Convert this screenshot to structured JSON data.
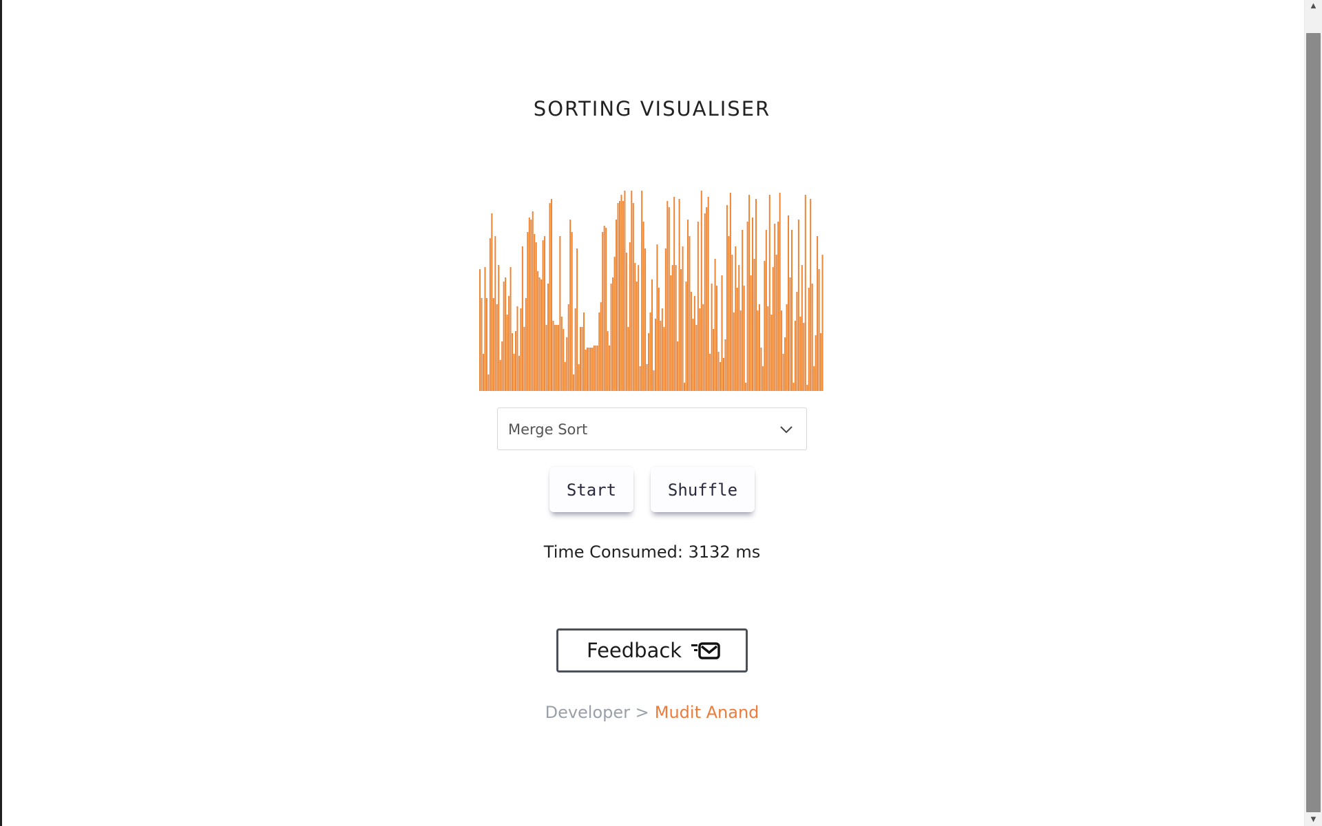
{
  "title": "SORTING VISUALISER",
  "chart_data": {
    "type": "bar",
    "bar_color": "#ef8432",
    "values": [
      59,
      45,
      18,
      60,
      45,
      8,
      74,
      86,
      45,
      75,
      42,
      61,
      15,
      24,
      53,
      55,
      37,
      46,
      60,
      28,
      18,
      29,
      41,
      17,
      40,
      70,
      31,
      45,
      77,
      84,
      83,
      87,
      76,
      72,
      58,
      55,
      54,
      73,
      75,
      32,
      52,
      91,
      93,
      34,
      32,
      32,
      32,
      75,
      36,
      30,
      14,
      26,
      42,
      83,
      77,
      8,
      40,
      69,
      13,
      31,
      31,
      38,
      20,
      21,
      21,
      21,
      21,
      22,
      22,
      22,
      38,
      43,
      77,
      80,
      79,
      29,
      22,
      52,
      55,
      65,
      83,
      91,
      92,
      95,
      92,
      97,
      67,
      31,
      72,
      97,
      91,
      62,
      53,
      61,
      12,
      97,
      82,
      69,
      13,
      28,
      38,
      54,
      10,
      35,
      71,
      50,
      34,
      40,
      31,
      69,
      92,
      89,
      56,
      61,
      94,
      61,
      24,
      93,
      59,
      70,
      4,
      53,
      83,
      75,
      48,
      35,
      46,
      32,
      82,
      40,
      97,
      42,
      86,
      89,
      94,
      18,
      52,
      30,
      64,
      51,
      19,
      14,
      56,
      16,
      25,
      90,
      75,
      96,
      66,
      38,
      70,
      50,
      61,
      39,
      78,
      51,
      4,
      82,
      95,
      56,
      84,
      64,
      93,
      39,
      42,
      21,
      12,
      63,
      78,
      41,
      95,
      37,
      60,
      81,
      66,
      82,
      96,
      39,
      18,
      26,
      42,
      85,
      55,
      78,
      4,
      34,
      48,
      83,
      36,
      61,
      33,
      95,
      3,
      50,
      93,
      52,
      12,
      27,
      75,
      59,
      28,
      66
    ]
  },
  "algorithm_select": {
    "selected": "Merge Sort"
  },
  "buttons": {
    "start": "Start",
    "shuffle": "Shuffle"
  },
  "time_consumed": "Time Consumed: 3132 ms",
  "feedback": {
    "label": "Feedback"
  },
  "footer": {
    "developer_label": "Developer >",
    "developer_name": "Mudit Anand"
  },
  "colors": {
    "accent": "#ef7b3a",
    "bars": "#ef8432"
  }
}
